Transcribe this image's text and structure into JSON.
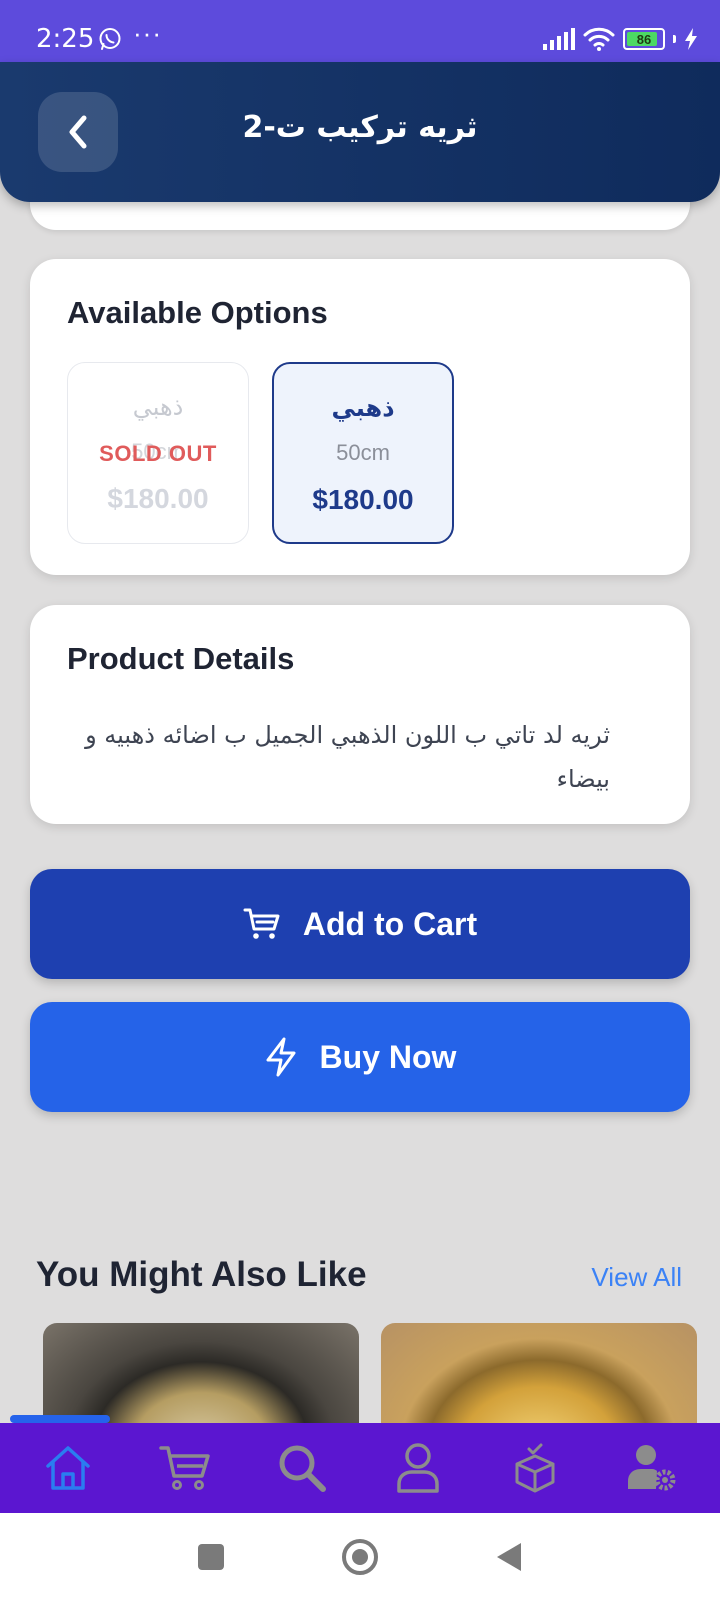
{
  "status_bar": {
    "time": "2:25",
    "dots": "···",
    "battery": "86"
  },
  "header": {
    "title": "ثريه تركيب ت-2"
  },
  "options": {
    "title": "Available Options",
    "items": [
      {
        "color": "ذهبي",
        "size": "50cm",
        "price": "$180.00",
        "badge": "SOLD OUT",
        "state": "sold-out"
      },
      {
        "color": "ذهبي",
        "size": "50cm",
        "price": "$180.00",
        "state": "selected"
      }
    ]
  },
  "details": {
    "title": "Product Details",
    "text": "ثريه لد تاتي ب اللون الذهبي الجميل ب اضائه ذهبيه و بيضاء"
  },
  "actions": {
    "add_to_cart": "Add to Cart",
    "buy_now": "Buy Now"
  },
  "related": {
    "title": "You Might Also Like",
    "view_all": "View All"
  },
  "bottom_nav": [
    {
      "icon": "home-icon",
      "active": true
    },
    {
      "icon": "cart-icon"
    },
    {
      "icon": "search-icon"
    },
    {
      "icon": "user-icon"
    },
    {
      "icon": "box-check-icon"
    },
    {
      "icon": "user-settings-icon"
    }
  ],
  "colors": {
    "status_bar": "#5d4bdc",
    "header": "#0f2b5c",
    "add_to_cart": "#1e40b0",
    "buy_now": "#2563e8",
    "bottom_nav": "#5b16d0",
    "sold_out": "#e05b5b",
    "link": "#3b82f6"
  }
}
